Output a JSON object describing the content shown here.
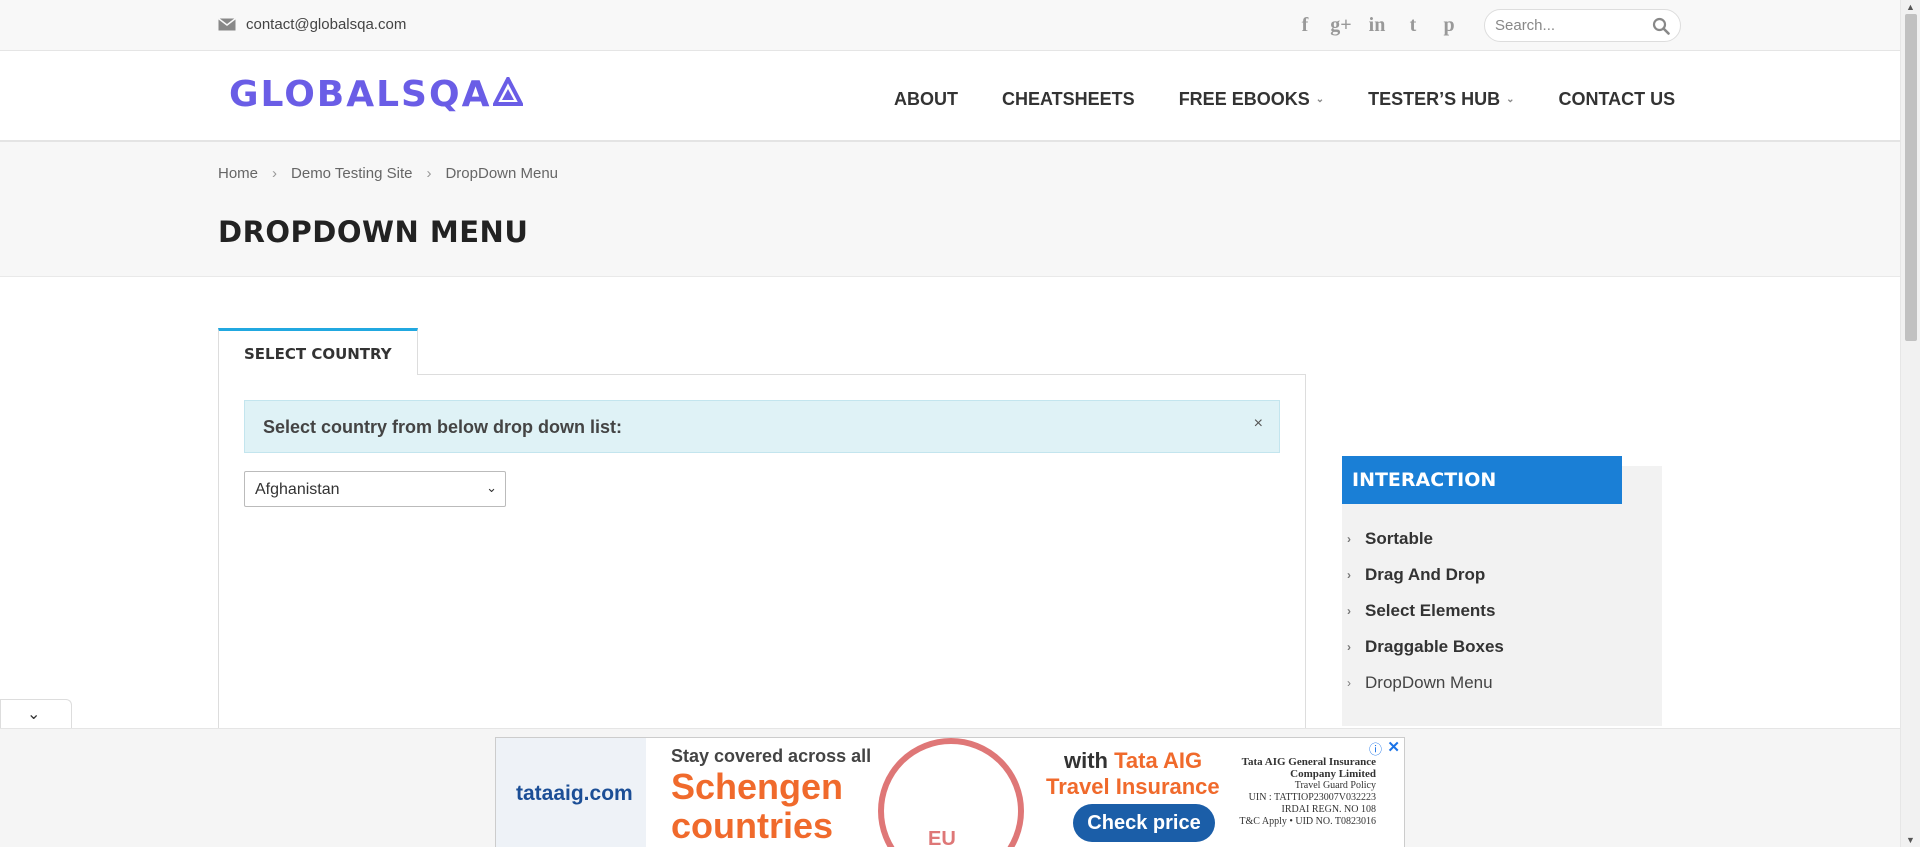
{
  "topbar": {
    "email": "contact@globalsqa.com",
    "socials": [
      "f",
      "g+",
      "in",
      "t",
      "p"
    ],
    "search_placeholder": "Search..."
  },
  "header": {
    "logo": "GLOBALSQA",
    "logo_mark": "A",
    "nav": [
      {
        "label": "ABOUT",
        "dropdown": false
      },
      {
        "label": "CHEATSHEETS",
        "dropdown": false
      },
      {
        "label": "FREE EBOOKS",
        "dropdown": true
      },
      {
        "label": "TESTER’S HUB",
        "dropdown": true
      },
      {
        "label": "CONTACT US",
        "dropdown": false
      }
    ],
    "caret": "⌄"
  },
  "breadcrumb": {
    "home": "Home",
    "sep": "›",
    "mid": "Demo Testing Site",
    "current": "DropDown Menu"
  },
  "page_title": "DROPDOWN MENU",
  "tab": {
    "label": "SELECT COUNTRY"
  },
  "alert": {
    "message": "Select country from below drop down list:",
    "close": "×"
  },
  "country_select": {
    "selected": "Afghanistan",
    "chevron": "⌄"
  },
  "sidebar": {
    "heading": "INTERACTION",
    "chevron": "›",
    "items": [
      "Sortable",
      "Drag And Drop",
      "Select Elements",
      "Draggable Boxes",
      "DropDown Menu"
    ]
  },
  "collapse_icon": "⌄",
  "ad": {
    "brand": "tataaig.com",
    "line1": "Stay covered across all",
    "big1": "Schengen",
    "big2": "countries",
    "stamp_text": "EU",
    "with_prefix": "with ",
    "with_brand": "Tata AIG",
    "travel": "Travel Insurance",
    "cta": "Check price",
    "fine_title": "Tata AIG General Insurance Company Limited",
    "fine_policy": "Travel Guard Policy",
    "fine_uin": "UIN : TATTIOP23007V032223",
    "fine_irdai": "IRDAI REGN. NO 108",
    "fine_tc": "T&C Apply • UID NO. T0823016",
    "info": "ⓘ",
    "close": "✕"
  },
  "colors": {
    "brand": "#6a5de6",
    "tab_accent": "#21a8e0",
    "sidebar_head": "#1a7fd6",
    "alert_bg": "#dff2f6"
  }
}
